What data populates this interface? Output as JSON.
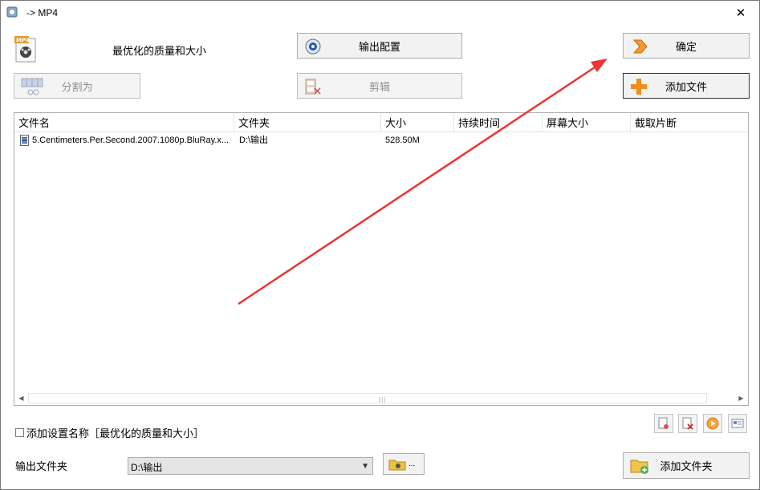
{
  "window": {
    "title": "-> MP4",
    "close_glyph": "✕"
  },
  "preset": {
    "name": "最优化的质量和大小",
    "icon": "mp4-file-icon"
  },
  "buttons": {
    "output_config": "输出配置",
    "ok": "确定",
    "split": "分割为",
    "edit": "剪辑",
    "add_file": "添加文件",
    "add_folder": "添加文件夹",
    "browse_dots": "..."
  },
  "table": {
    "columns": [
      "文件名",
      "文件夹",
      "大小",
      "持续时间",
      "屏幕大小",
      "截取片断"
    ],
    "rows": [
      {
        "name": "5.Centimeters.Per.Second.2007.1080p.BluRay.x...",
        "folder": "D:\\输出",
        "size": "528.50M",
        "duration": "",
        "screen": "",
        "clip": ""
      }
    ],
    "scroll_grip": "|||"
  },
  "options": {
    "add_setting_name_label": "添加设置名称［最优化的质量和大小］",
    "add_setting_name_checked": false
  },
  "output": {
    "label": "输出文件夹",
    "folder": "D:\\输出"
  },
  "colors": {
    "annotation_arrow": "#ee3333",
    "add_plus": "#f28c1c"
  }
}
